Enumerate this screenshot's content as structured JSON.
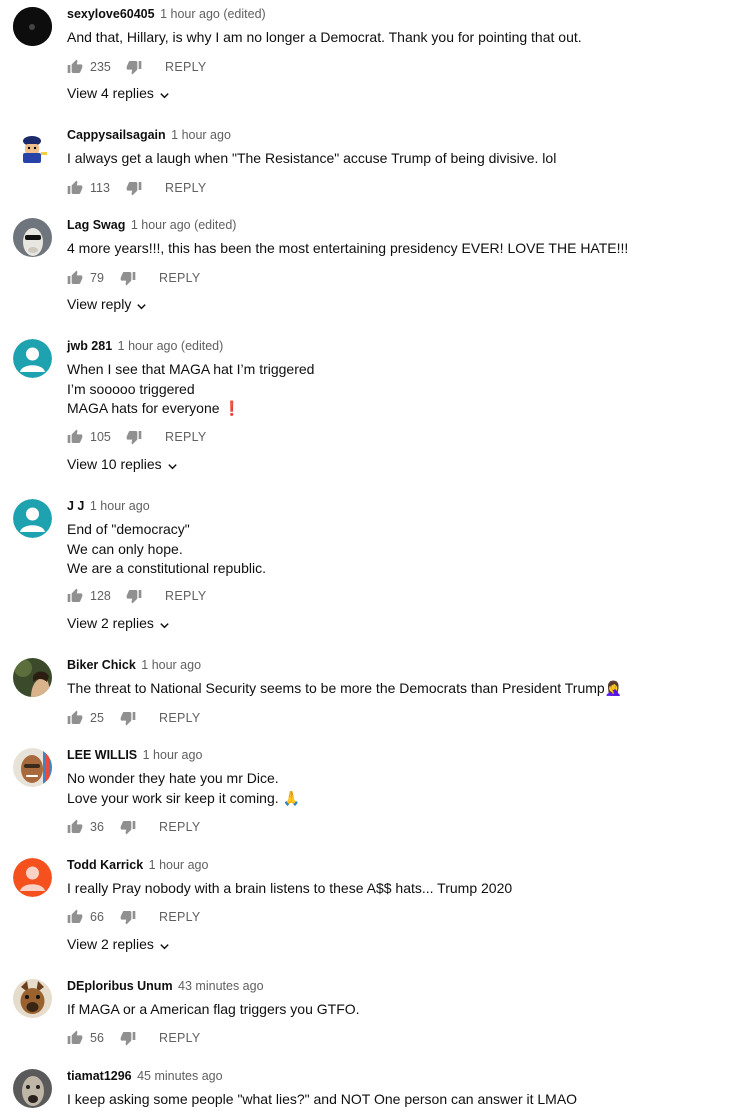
{
  "comments": [
    {
      "author": "sexylove60405",
      "time": "1 hour ago (edited)",
      "lines": [
        "And that, Hillary, is why I am no longer a Democrat. Thank you for pointing that out."
      ],
      "likes": "235",
      "reply": "REPLY",
      "view_replies": "View 4 replies",
      "avatar": {
        "type": "photo",
        "bg": "#111111"
      }
    },
    {
      "author": "Cappysailsagain",
      "time": "1 hour ago",
      "lines": [
        "I always get a laugh when \"The Resistance\" accuse Trump of being divisive.  lol"
      ],
      "likes": "113",
      "reply": "REPLY",
      "view_replies": "",
      "avatar": {
        "type": "cartoon",
        "bg": "#ffffff"
      }
    },
    {
      "author": "Lag Swag",
      "time": "1 hour ago (edited)",
      "lines": [
        "4 more years!!!, this has been the most entertaining presidency EVER! LOVE THE HATE!!!"
      ],
      "likes": "79",
      "reply": "REPLY",
      "view_replies": "View reply",
      "avatar": {
        "type": "llama",
        "bg": "#7a7f86"
      }
    },
    {
      "author": "jwb 281",
      "time": "1 hour ago (edited)",
      "lines": [
        "When I see that MAGA hat I’m triggered",
        "I’m sooooo triggered",
        "MAGA hats for everyone ❗"
      ],
      "likes": "105",
      "reply": "REPLY",
      "view_replies": "View 10 replies",
      "avatar": {
        "type": "default",
        "bg": "#1fa2b0"
      }
    },
    {
      "author": "J J",
      "time": "1 hour ago",
      "lines": [
        "End of \"democracy\"",
        "We can only hope.",
        "We are a constitutional republic."
      ],
      "likes": "128",
      "reply": "REPLY",
      "view_replies": "View 2 replies",
      "avatar": {
        "type": "default",
        "bg": "#1fa2b0"
      }
    },
    {
      "author": "Biker Chick",
      "time": "1 hour ago",
      "lines": [
        "The threat to National Security seems to be more the Democrats than President Trump🤦‍♀️"
      ],
      "likes": "25",
      "reply": "REPLY",
      "view_replies": "",
      "avatar": {
        "type": "photo",
        "bg": "#3c4a2c"
      }
    },
    {
      "author": "LEE WILLIS",
      "time": "1 hour ago",
      "lines": [
        "No wonder they hate you mr Dice.",
        "Love your work sir keep it coming. 🙏"
      ],
      "likes": "36",
      "reply": "REPLY",
      "view_replies": "",
      "avatar": {
        "type": "face",
        "bg": "#c98a4f"
      }
    },
    {
      "author": "Todd Karrick",
      "time": "1 hour ago",
      "lines": [
        "I really Pray nobody with a brain listens to these A$$ hats... Trump 2020"
      ],
      "likes": "66",
      "reply": "REPLY",
      "view_replies": "View 2 replies",
      "avatar": {
        "type": "default",
        "bg": "#f4511e"
      }
    },
    {
      "author": "DEploribus Unum",
      "time": "43 minutes ago",
      "lines": [
        "If MAGA or a American flag triggers you GTFO."
      ],
      "likes": "56",
      "reply": "REPLY",
      "view_replies": "",
      "avatar": {
        "type": "dog",
        "bg": "#8a5a2b"
      }
    },
    {
      "author": "tiamat1296",
      "time": "45 minutes ago",
      "lines": [
        "I keep asking some people \"what lies?\" and NOT One person can answer it LMAO"
      ],
      "likes": "",
      "reply": "",
      "view_replies": "",
      "avatar": {
        "type": "face2",
        "bg": "#777777"
      }
    }
  ]
}
